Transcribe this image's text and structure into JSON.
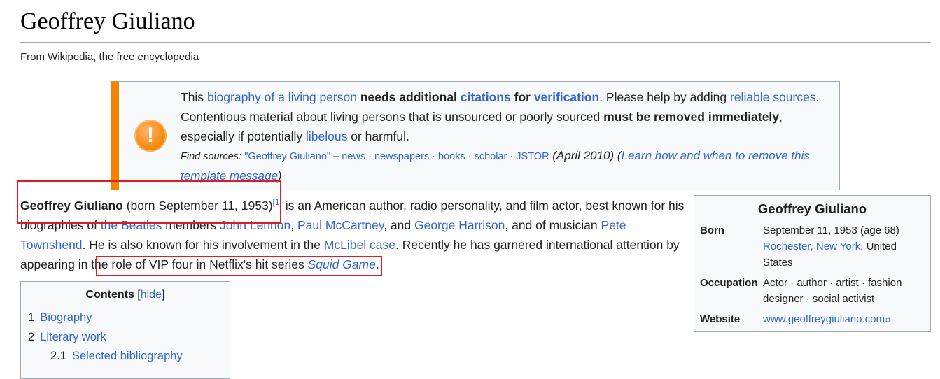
{
  "header": {
    "title": "Geoffrey Giuliano",
    "tagline": "From Wikipedia, the free encyclopedia"
  },
  "ambox": {
    "icon": "exclamation-icon",
    "accent_color": "#f28500",
    "line1": {
      "t1": "This ",
      "l1": "biography of a living person",
      "b1": " needs additional ",
      "l2": "citations",
      "b2": " for ",
      "l3": "verification",
      "t2": ". Please help by adding ",
      "l4": "reliable sources",
      "t3": "."
    },
    "line2": {
      "t1": "Contentious material about living persons that is unsourced or poorly sourced ",
      "b1": "must be removed immediately",
      "t2": ","
    },
    "line3": {
      "t1": "especially if potentially ",
      "l1": "libelous",
      "t2": " or harmful."
    },
    "find_sources": {
      "label": "Find sources:",
      "query": "\"Geoffrey Giuliano\"",
      "dash": " – ",
      "news": "news",
      "newspapers": "newspapers",
      "books": "books",
      "scholar": "scholar",
      "jstor": "JSTOR",
      "sep": " · ",
      "date": " (April 2010) (",
      "learn": "Learn how and when to remove this template message",
      "close": ")"
    }
  },
  "lead": {
    "name": "Geoffrey Giuliano",
    "born": " (born September 11, 1953)",
    "ref": "[1]",
    "t1": " is an American author, radio personality, and film actor, best known for his biographies of ",
    "beatles": "the Beatles",
    "t2": " members ",
    "lennon": "John Lennon",
    "c1": ", ",
    "mccartney": "Paul McCartney",
    "c2": ", and ",
    "harrison": "George Harrison",
    "t3": ", and of musician ",
    "townshend": "Pete Townshend",
    "t4": ". He is also known for his involvement in the ",
    "mclibel": "McLibel case",
    "t5": ". Recently he has garnered international attention by appearing in the role of VIP four in Netflix's hit series ",
    "squid": "Squid Game",
    "t6": "."
  },
  "toc": {
    "title": "Contents",
    "hide_open": " [",
    "hide": "hide",
    "hide_close": "]",
    "items": [
      {
        "num": "1",
        "label": "Biography"
      },
      {
        "num": "2",
        "label": "Literary work"
      },
      {
        "num": "2.1",
        "label": "Selected bibliography"
      }
    ]
  },
  "infobox": {
    "title": "Geoffrey Giuliano",
    "born_label": "Born",
    "born_date": "September 11, 1953 (age 68)",
    "born_city": "Rochester",
    "born_comma": ", ",
    "born_state": "New York",
    "born_country": ", United States",
    "occupation_label": "Occupation",
    "occupation_value": "Actor · author · artist · fashion designer · social activist",
    "website_label": "Website",
    "website_value": "www.geoffreygiuliano.com",
    "website_icon": "external-link-icon"
  },
  "annotation_color": "#e01b24"
}
